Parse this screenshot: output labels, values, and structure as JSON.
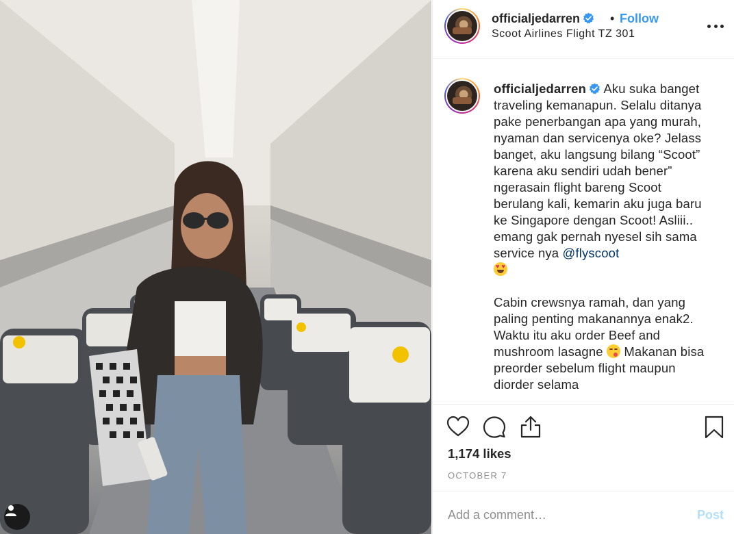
{
  "post": {
    "username": "officialjedarren",
    "verified": true,
    "separator": "•",
    "follow_label": "Follow",
    "location": "Scoot Airlines Flight TZ 301",
    "photo_description_icon": "user-tag-icon"
  },
  "caption": {
    "username": "officialjedarren",
    "paragraph1": "Aku suka banget traveling kemanapun. Selalu ditanya pake penerbangan apa yang murah, nyaman dan servicenya oke? Jelass banget, aku langsung bilang “Scoot” karena aku sendiri udah bener” ngerasain flight bareng Scoot berulang kali, kemarin aku juga baru ke Singapore dengan Scoot! Asliii.. emang gak pernah nyesel sih sama service nya",
    "mention": "@flyscoot",
    "emoji1": "heart-eyes-emoji",
    "paragraph2a": "Cabin crewsnya ramah, dan yang paling penting makanannya enak2. Waktu itu aku order Beef and mushroom lasagne",
    "emoji2": "yum-emoji",
    "paragraph2b": "Makanan bisa preorder sebelum flight maupun diorder selama"
  },
  "actions": {
    "like_icon": "heart-icon",
    "comment_icon": "comment-icon",
    "share_icon": "share-icon",
    "save_icon": "bookmark-icon",
    "likes_text": "1,174 likes",
    "date": "OCTOBER 7"
  },
  "comment_box": {
    "placeholder": "Add a comment…",
    "post_label": "Post"
  },
  "colors": {
    "link_blue": "#3897f0",
    "mention_blue": "#003569",
    "post_disabled": "#b2dffc",
    "muted_gray": "#8e8e8e"
  }
}
